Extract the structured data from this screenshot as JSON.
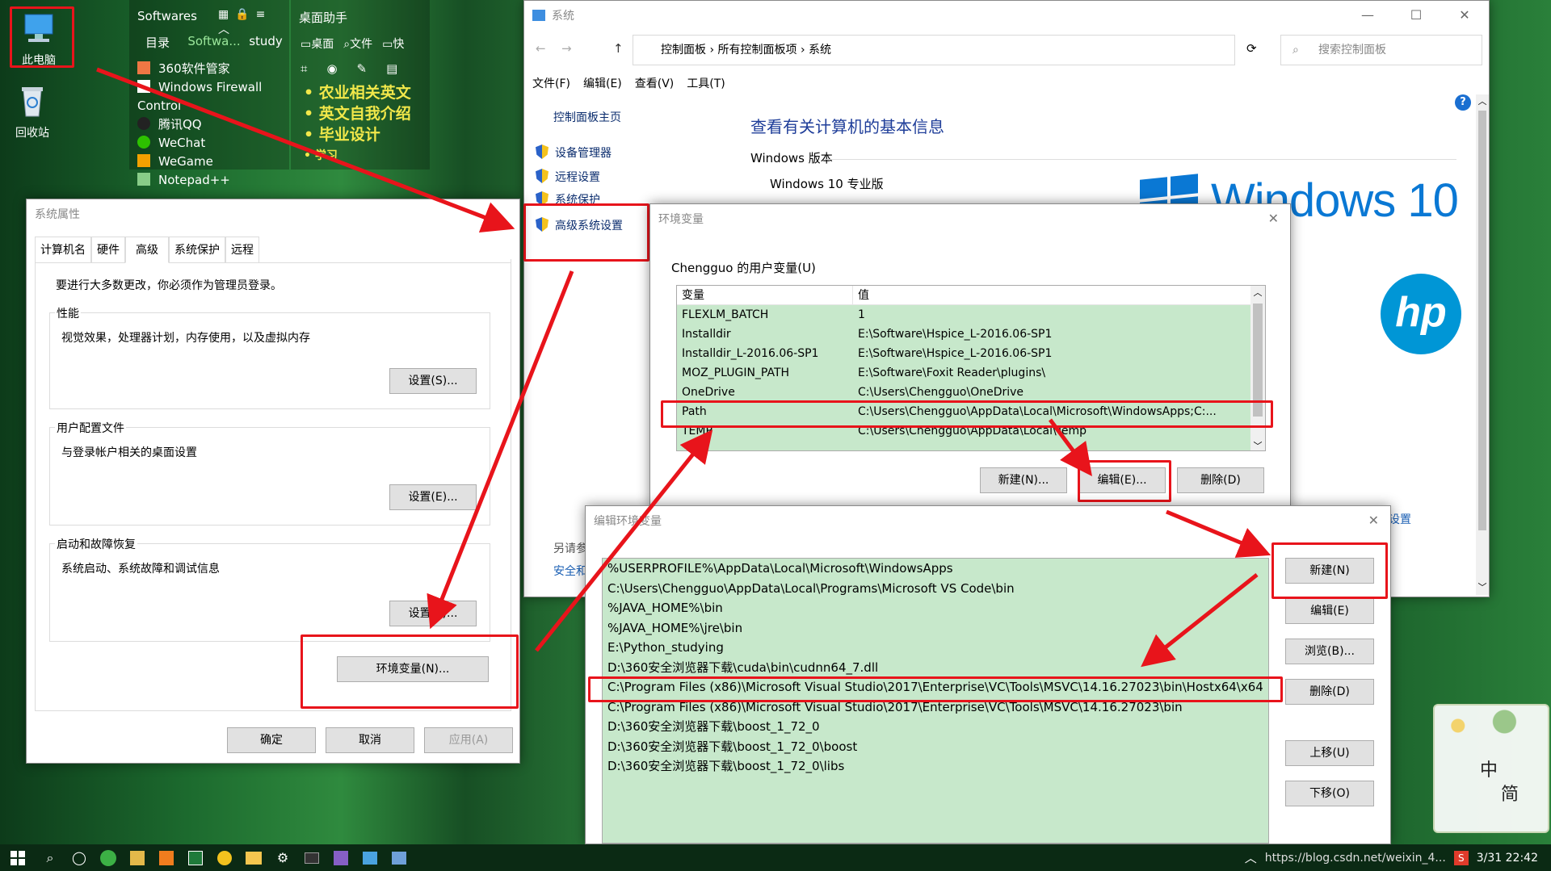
{
  "desktop": {
    "icons": [
      {
        "label": "此电脑"
      },
      {
        "label": "回收站"
      }
    ],
    "fence": {
      "title": "Softwares",
      "tabs": [
        "目录",
        "Softwa...",
        "study"
      ],
      "items": [
        "360软件管家",
        "Windows Firewall Control",
        "腾讯QQ",
        "WeChat",
        "WeGame",
        "Notepad++"
      ]
    },
    "helper": {
      "title": "桌面助手",
      "tabs": [
        "桌面",
        "文件",
        "快"
      ],
      "notes": [
        "• 农业相关英文",
        "• 英文自我介绍",
        "• 毕业设计",
        "• 学习"
      ]
    }
  },
  "system_window": {
    "title": "系统",
    "breadcrumb": [
      "控制面板",
      "所有控制面板项",
      "系统"
    ],
    "search_placeholder": "搜索控制面板",
    "menu": [
      "文件(F)",
      "编辑(E)",
      "查看(V)",
      "工具(T)"
    ],
    "side_home": "控制面板主页",
    "side_links": [
      "设备管理器",
      "远程设置",
      "系统保护",
      "高级系统设置"
    ],
    "side_bottom": [
      "另请参",
      "安全和"
    ],
    "heading": "查看有关计算机的基本信息",
    "version_label": "Windows 版本",
    "edition": "Windows 10 专业版",
    "brand": "Windows 10",
    "settings_link": "设置"
  },
  "sys_props": {
    "title": "系统属性",
    "tabs": [
      "计算机名",
      "硬件",
      "高级",
      "系统保护",
      "远程"
    ],
    "admin_note": "要进行大多数更改，你必须作为管理员登录。",
    "groups": [
      {
        "title": "性能",
        "desc": "视觉效果，处理器计划，内存使用，以及虚拟内存",
        "button": "设置(S)..."
      },
      {
        "title": "用户配置文件",
        "desc": "与登录帐户相关的桌面设置",
        "button": "设置(E)..."
      },
      {
        "title": "启动和故障恢复",
        "desc": "系统启动、系统故障和调试信息",
        "button": "设置(T)..."
      }
    ],
    "env_button": "环境变量(N)...",
    "ok": "确定",
    "cancel": "取消",
    "apply": "应用(A)"
  },
  "env_vars": {
    "title": "环境变量",
    "user_section": "Chengguo 的用户变量(U)",
    "col_var": "变量",
    "col_val": "值",
    "rows": [
      {
        "name": "FLEXLM_BATCH",
        "value": "1"
      },
      {
        "name": "Installdir",
        "value": "E:\\Software\\Hspice_L-2016.06-SP1"
      },
      {
        "name": "Installdir_L-2016.06-SP1",
        "value": "E:\\Software\\Hspice_L-2016.06-SP1"
      },
      {
        "name": "MOZ_PLUGIN_PATH",
        "value": "E:\\Software\\Foxit Reader\\plugins\\"
      },
      {
        "name": "OneDrive",
        "value": "C:\\Users\\Chengguo\\OneDrive"
      },
      {
        "name": "Path",
        "value": "C:\\Users\\Chengguo\\AppData\\Local\\Microsoft\\WindowsApps;C:..."
      },
      {
        "name": "TEMP",
        "value": "C:\\Users\\Chengguo\\AppData\\Local\\Temp"
      }
    ],
    "new": "新建(N)...",
    "edit": "编辑(E)...",
    "delete": "删除(D)"
  },
  "edit_env": {
    "title": "编辑环境变量",
    "entries": [
      "%USERPROFILE%\\AppData\\Local\\Microsoft\\WindowsApps",
      "C:\\Users\\Chengguo\\AppData\\Local\\Programs\\Microsoft VS Code\\bin",
      "%JAVA_HOME%\\bin",
      "%JAVA_HOME%\\jre\\bin",
      "E:\\Python_studying",
      "D:\\360安全浏览器下载\\cuda\\bin\\cudnn64_7.dll",
      "C:\\Program Files (x86)\\Microsoft Visual Studio\\2017\\Enterprise\\VC\\Tools\\MSVC\\14.16.27023\\bin\\Hostx64\\x64",
      "C:\\Program Files (x86)\\Microsoft Visual Studio\\2017\\Enterprise\\VC\\Tools\\MSVC\\14.16.27023\\bin",
      "D:\\360安全浏览器下载\\boost_1_72_0",
      "D:\\360安全浏览器下载\\boost_1_72_0\\boost",
      "D:\\360安全浏览器下载\\boost_1_72_0\\libs"
    ],
    "buttons": [
      "新建(N)",
      "编辑(E)",
      "浏览(B)...",
      "删除(D)",
      "上移(U)",
      "下移(O)"
    ]
  },
  "ime": {
    "top": "中",
    "bottom": "简"
  },
  "taskbar": {
    "tray_text": "https://blog.csdn.net/weixin_4...",
    "clock": "3/31 22:42"
  },
  "colors": {
    "highlight": "#c7e8cb",
    "annotation": "#e8141b",
    "link": "#1a5fb4"
  }
}
